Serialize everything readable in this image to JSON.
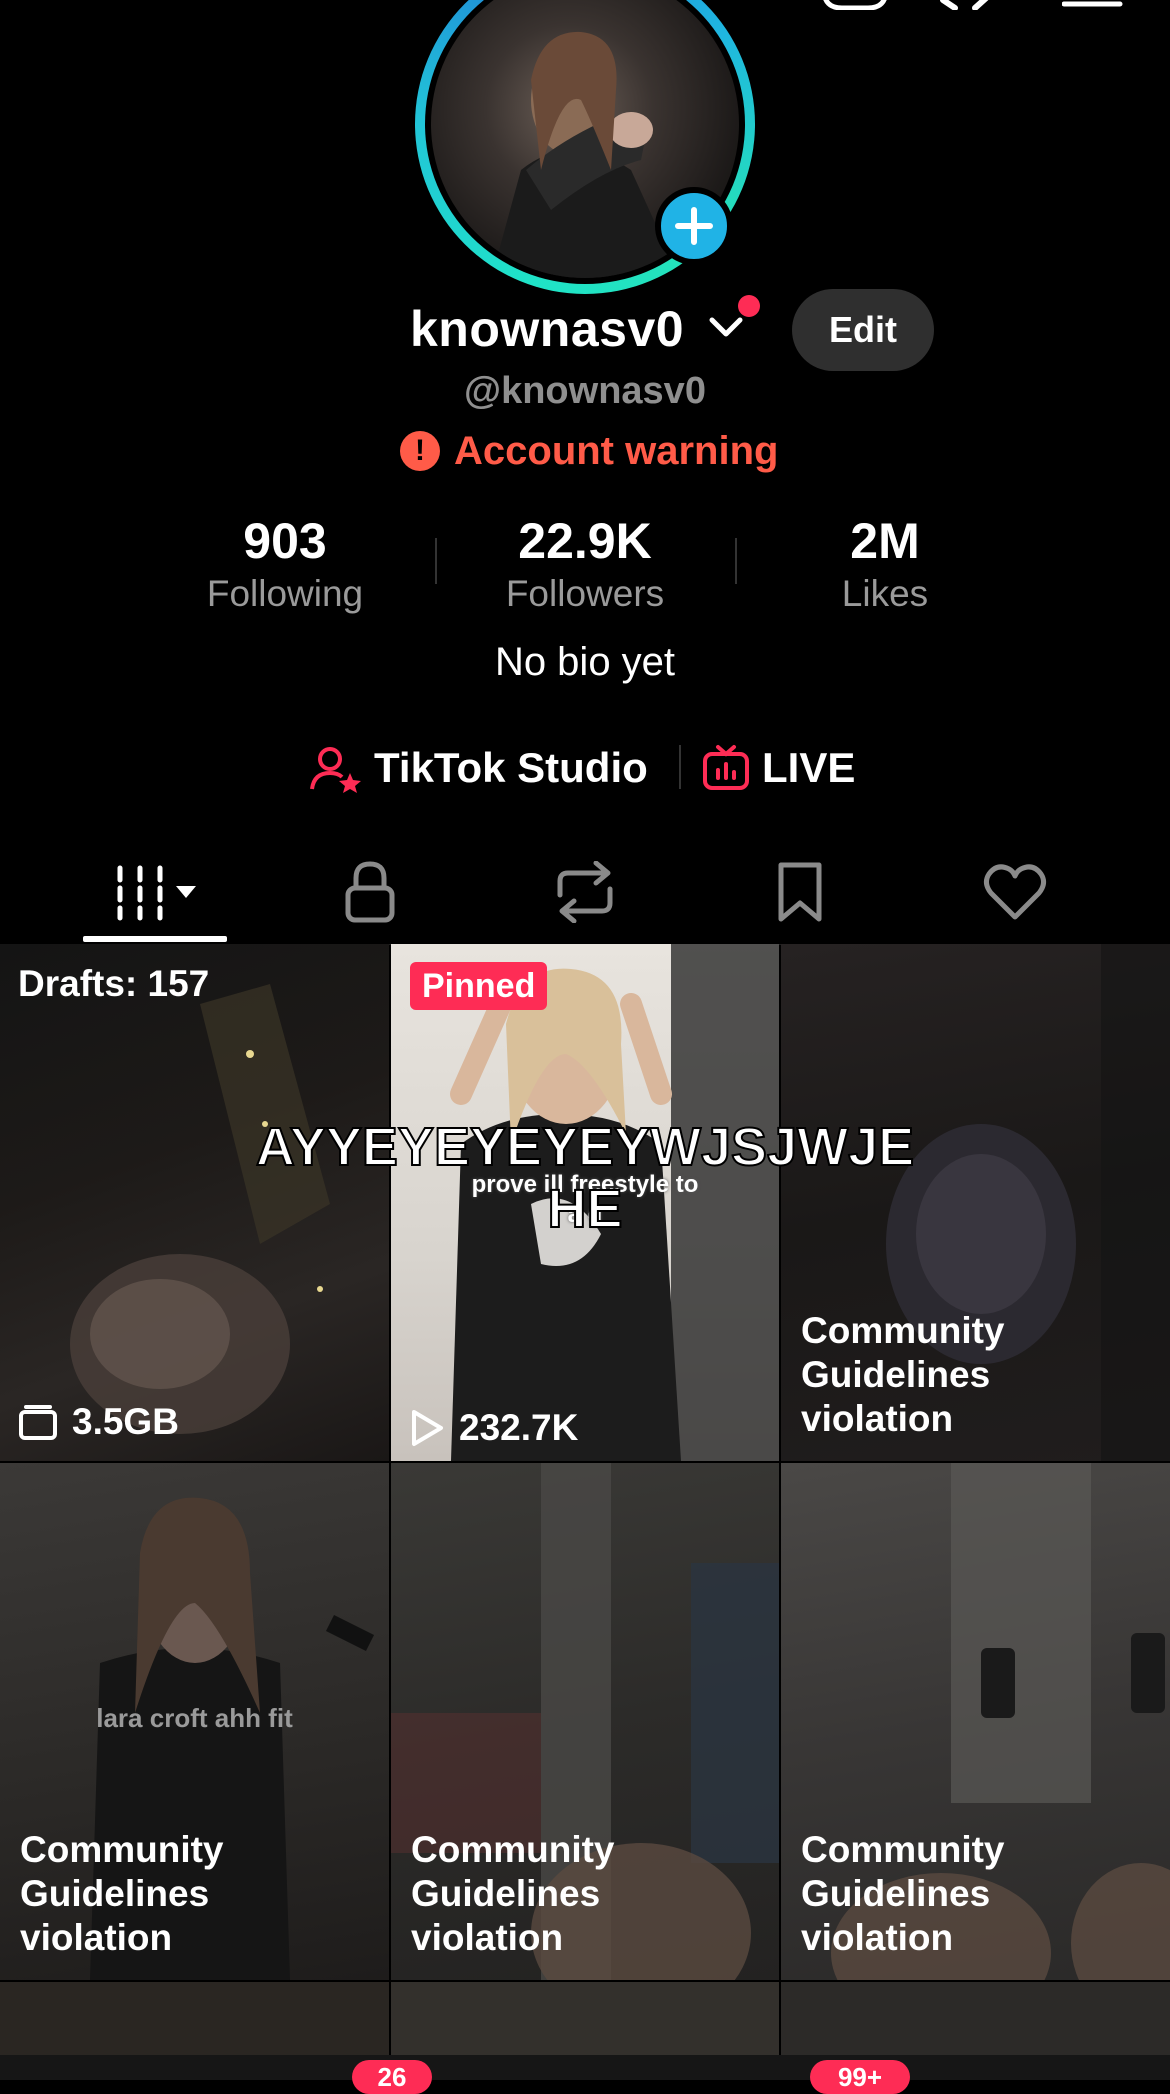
{
  "profile": {
    "username": "knownasv0",
    "handle": "@knownasv0",
    "edit_label": "Edit",
    "warning_text": "Account warning",
    "bio": "No bio yet"
  },
  "stats": [
    {
      "value": "903",
      "label": "Following"
    },
    {
      "value": "22.9K",
      "label": "Followers"
    },
    {
      "value": "2M",
      "label": "Likes"
    }
  ],
  "tools": {
    "studio_label": "TikTok Studio",
    "live_label": "LIVE"
  },
  "tabs": [
    {
      "icon": "grid-icon"
    },
    {
      "icon": "lock-icon"
    },
    {
      "icon": "repost-icon"
    },
    {
      "icon": "bookmark-icon"
    },
    {
      "icon": "heart-icon"
    }
  ],
  "grid": {
    "drafts_label": "Drafts: 157",
    "drafts_size": "3.5GB",
    "pinned_label": "Pinned",
    "pinned_views": "232.7K",
    "pinned_caption": "prove ill freestyle to\na g",
    "row2_caption": "lara croft ahh fit",
    "overlay_caption_line1": "AYYEYEYEYEYWJSJWJE",
    "overlay_caption_line2": "HE",
    "violation_label": "Community\nGuidelines\nviolation",
    "violation_label_1": "Community",
    "violation_label_2": "Guidelines",
    "violation_label_3": "violation"
  },
  "nav_badges": [
    {
      "text": "26"
    },
    {
      "text": "99+"
    }
  ],
  "colors": {
    "accent_red": "#fe2c55",
    "warning": "#ff5b48",
    "ring_cyan": "#1fe3c8",
    "plus_blue": "#20b3e6"
  }
}
